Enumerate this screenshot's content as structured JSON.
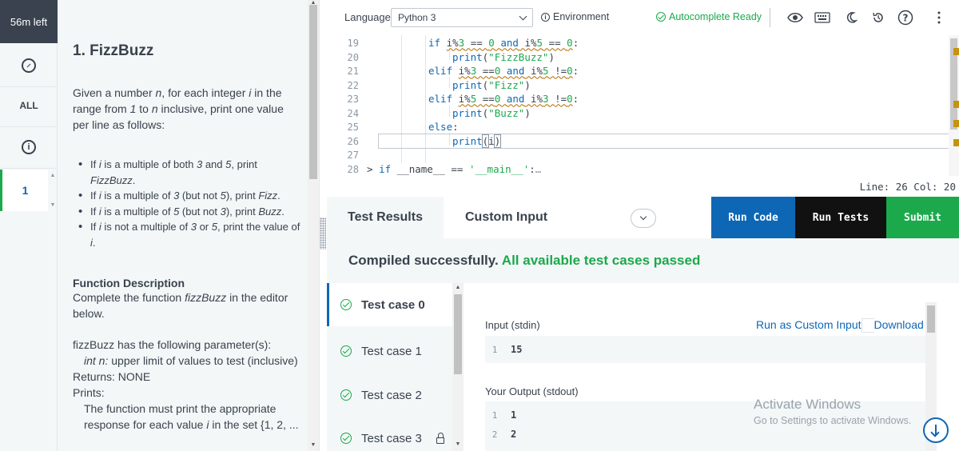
{
  "timer": "56m left",
  "rail": {
    "all_label": "ALL",
    "question_number": "1"
  },
  "problem": {
    "title": "1. FizzBuzz",
    "intro_1": "Given a number ",
    "intro_n": "n",
    "intro_2": ", for each integer ",
    "intro_i": "i",
    "intro_3": " in the range from ",
    "intro_1v": "1",
    "intro_4": " to ",
    "intro_n2": "n",
    "intro_5": " inclusive, print one value per line as follows:",
    "rules": [
      {
        "a": "If ",
        "i": "i",
        "b": " is a multiple of both ",
        "x": "3",
        "c": " and ",
        "y": "5",
        "d": ", print ",
        "z": "FizzBuzz",
        "e": "."
      },
      {
        "a": "If ",
        "i": "i",
        "b": " is a multiple of ",
        "x": "3",
        "c": " (but not ",
        "y": "5",
        "d": "), print ",
        "z": "Fizz",
        "e": "."
      },
      {
        "a": "If ",
        "i": "i",
        "b": " is a multiple of ",
        "x": "5",
        "c": " (but not ",
        "y": "3",
        "d": "), print ",
        "z": "Buzz",
        "e": "."
      },
      {
        "a": "If ",
        "i": "i",
        "b": " is not a multiple of ",
        "x": "3",
        "c": " or ",
        "y": "5",
        "d": ", print the value of ",
        "z": "i",
        "e": "."
      }
    ],
    "fd_title": "Function Description",
    "fd_body_1": "Complete the function ",
    "fd_body_fn": "fizzBuzz",
    "fd_body_2": " in the editor below.",
    "params_title": "fizzBuzz has the following parameter(s):",
    "param_name": "int n:",
    "param_desc": "  upper limit of values to test (inclusive)",
    "returns": "Returns:    NONE",
    "prints": "Prints:",
    "prints_body_1": "The function must print the appropriate response for each value ",
    "prints_i": "i",
    "prints_body_2": " in the set {1, 2, ..."
  },
  "toolbar": {
    "language_label": "Language",
    "language_value": "Python 3",
    "environment_label": "Environment",
    "autocomplete_label": "Autocomplete Ready"
  },
  "editor": {
    "line_numbers": [
      "19",
      "20",
      "21",
      "22",
      "23",
      "24",
      "25",
      "26",
      "27",
      "28"
    ],
    "status": "Line: 26  Col: 20"
  },
  "results": {
    "tab_results": "Test Results",
    "tab_custom": "Custom Input",
    "run_code": "Run Code",
    "run_tests": "Run Tests",
    "submit": "Submit",
    "compile_msg": "Compiled successfully.",
    "pass_msg": "All available test cases passed",
    "cases": [
      "Test case 0",
      "Test case 1",
      "Test case 2",
      "Test case 3"
    ],
    "input_label": "Input (stdin)",
    "run_custom": "Run as Custom Input",
    "download": "Download",
    "input_lines": [
      {
        "n": "1",
        "v": "15"
      }
    ],
    "output_label": "Your Output (stdout)",
    "output_lines": [
      {
        "n": "1",
        "v": "1"
      },
      {
        "n": "2",
        "v": "2"
      }
    ]
  },
  "watermark": {
    "title": "Activate Windows",
    "subtitle": "Go to Settings to activate Windows."
  },
  "colors": {
    "accent": "#0e67b5",
    "success": "#1ba94c",
    "dark": "#39424e"
  }
}
